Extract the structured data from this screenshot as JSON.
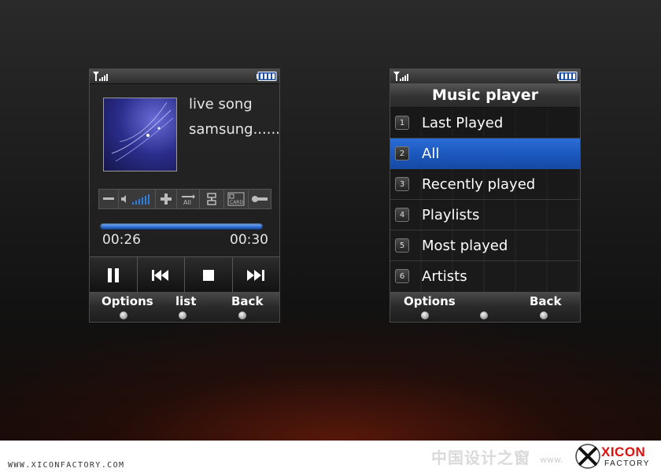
{
  "player": {
    "song_title": "live song",
    "artist": "samsung......",
    "elapsed": "00:26",
    "total": "00:30",
    "progress_fraction": 0.96,
    "controls": [
      "minus-icon",
      "volume-icon",
      "plus-icon",
      "repeat-all-icon",
      "shuffle-icon",
      "card-icon",
      "equalizer-icon"
    ],
    "repeat_label": "All",
    "card_label": "CARD",
    "softkeys": {
      "left": "Options",
      "center": "list",
      "right": "Back"
    }
  },
  "music_menu": {
    "title": "Music player",
    "items": [
      {
        "num": "1",
        "label": "Last Played"
      },
      {
        "num": "2",
        "label": "All"
      },
      {
        "num": "3",
        "label": "Recently played"
      },
      {
        "num": "4",
        "label": "Playlists"
      },
      {
        "num": "5",
        "label": "Most played"
      },
      {
        "num": "6",
        "label": "Artists"
      }
    ],
    "selected_index": 1,
    "softkeys": {
      "left": "Options",
      "right": "Back"
    }
  },
  "footer": {
    "url": "WWW.XICONFACTORY.COM",
    "watermark": "中国设计之窗",
    "watermark_small": "www.",
    "logo_word": "XICON",
    "logo_sub": "FACTORY"
  },
  "colors": {
    "accent": "#1f5fc8",
    "background": "#1a1a1a"
  }
}
